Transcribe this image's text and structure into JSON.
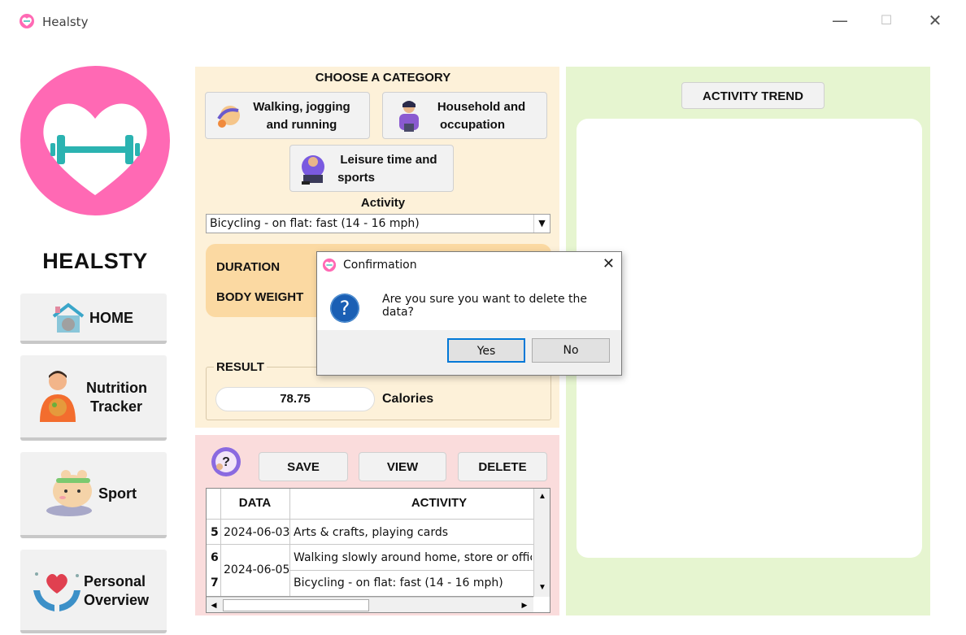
{
  "window": {
    "title": "Healsty"
  },
  "sidebar": {
    "brand": "HEALSTY",
    "items": [
      {
        "label": "HOME"
      },
      {
        "label1": "Nutrition",
        "label2": "Tracker"
      },
      {
        "label": "Sport"
      },
      {
        "label1": "Personal",
        "label2": "Overview"
      }
    ]
  },
  "category": {
    "title": "CHOOSE A CATEGORY",
    "buttons": [
      {
        "line1": "Walking, jogging",
        "line2": "and running"
      },
      {
        "line1": "Household and",
        "line2": "occupation"
      },
      {
        "line1": "Leisure time and",
        "line2": "sports"
      }
    ],
    "activity_label": "Activity",
    "activity_value": "Bicycling - on flat: fast (14 - 16 mph)"
  },
  "inputs": {
    "duration_label": "DURATION",
    "weight_label": "BODY WEIGHT"
  },
  "result": {
    "label": "RESULT",
    "value": "78.75",
    "unit": "Calories"
  },
  "actions": {
    "save": "SAVE",
    "view": "VIEW",
    "delete": "DELETE"
  },
  "table": {
    "headers": [
      "DATA",
      "ACTIVITY"
    ],
    "rows": [
      {
        "index": "5",
        "date": "2024-06-03",
        "activity": "Arts & crafts, playing cards"
      },
      {
        "index": "6",
        "date": "2024-06-05",
        "activity": "Walking slowly around home, store or office"
      },
      {
        "index": "7",
        "date": "",
        "activity": "Bicycling - on flat: fast (14 - 16 mph)"
      }
    ]
  },
  "trend": {
    "button": "ACTIVITY TREND"
  },
  "dialog": {
    "title": "Confirmation",
    "message": "Are you sure you want to delete the data?",
    "yes": "Yes",
    "no": "No"
  },
  "colors": {
    "brand_pink": "#ff69b4",
    "dumbbell_teal": "#2bb3b1",
    "category_panel": "#fdf1d9",
    "input_box": "#fbd9a2",
    "data_panel": "#fadcdc",
    "trend_panel": "#e6f5d0",
    "question_blue": "#1a5fb4"
  }
}
